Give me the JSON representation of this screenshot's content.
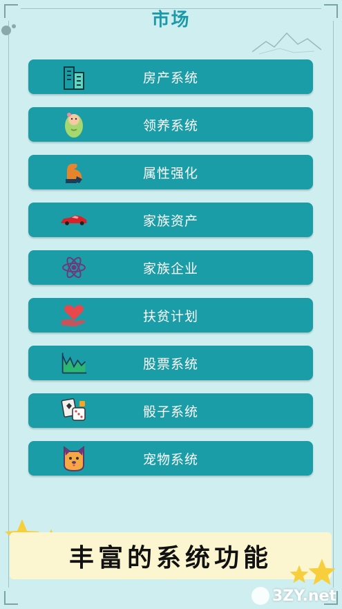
{
  "page": {
    "title": "市场"
  },
  "menu": {
    "items": [
      {
        "label": "房产系统",
        "icon": "building-icon"
      },
      {
        "label": "领养系统",
        "icon": "baby-icon"
      },
      {
        "label": "属性强化",
        "icon": "muscle-arm-icon"
      },
      {
        "label": "家族资产",
        "icon": "car-icon"
      },
      {
        "label": "家族企业",
        "icon": "atom-icon"
      },
      {
        "label": "扶贫计划",
        "icon": "heart-hand-icon"
      },
      {
        "label": "股票系统",
        "icon": "stock-chart-icon"
      },
      {
        "label": "骰子系统",
        "icon": "dice-cards-icon"
      },
      {
        "label": "宠物系统",
        "icon": "pet-dog-icon"
      }
    ]
  },
  "banner": {
    "text": "丰富的系统功能"
  },
  "watermark": {
    "text": "3ZY.net"
  },
  "colors": {
    "background": "#cfeef0",
    "button": "#1a9da6",
    "title": "#1b9aa8",
    "banner": "#fbf6cf",
    "star": "#f7cf3c"
  }
}
